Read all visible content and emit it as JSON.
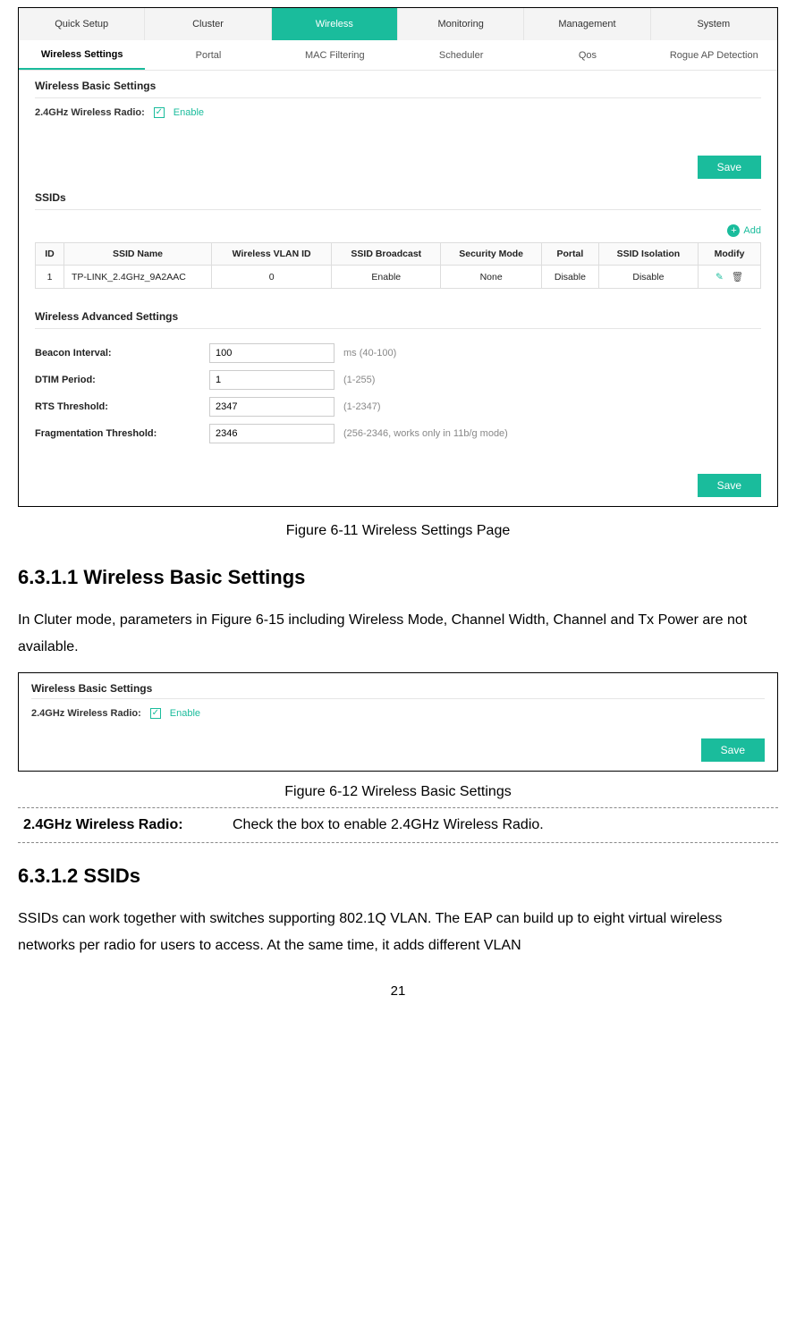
{
  "mainTabs": [
    "Quick Setup",
    "Cluster",
    "Wireless",
    "Monitoring",
    "Management",
    "System"
  ],
  "mainActive": 2,
  "subTabs": [
    "Wireless Settings",
    "Portal",
    "MAC Filtering",
    "Scheduler",
    "Qos",
    "Rogue AP Detection"
  ],
  "subActive": 0,
  "basic": {
    "title": "Wireless Basic Settings",
    "radioLabel": "2.4GHz Wireless Radio:",
    "enable": "Enable"
  },
  "saveLabel": "Save",
  "ssids": {
    "title": "SSIDs",
    "addLabel": "Add",
    "headers": [
      "ID",
      "SSID Name",
      "Wireless VLAN ID",
      "SSID Broadcast",
      "Security Mode",
      "Portal",
      "SSID Isolation",
      "Modify"
    ],
    "row": {
      "id": "1",
      "name": "TP-LINK_2.4GHz_9A2AAC",
      "vlan": "0",
      "bc": "Enable",
      "sec": "None",
      "portal": "Disable",
      "iso": "Disable"
    }
  },
  "adv": {
    "title": "Wireless Advanced Settings",
    "rows": [
      {
        "label": "Beacon Interval:",
        "value": "100",
        "hint": "ms (40-100)"
      },
      {
        "label": "DTIM Period:",
        "value": "1",
        "hint": "(1-255)"
      },
      {
        "label": "RTS Threshold:",
        "value": "2347",
        "hint": "(1-2347)"
      },
      {
        "label": "Fragmentation Threshold:",
        "value": "2346",
        "hint": "(256-2346, works only in 11b/g mode)"
      }
    ]
  },
  "cap1": "Figure 6-11 Wireless Settings Page",
  "sec1": "6.3.1.1  Wireless Basic Settings",
  "para1": "In Cluter mode, parameters in Figure 6-15 including Wireless Mode, Channel Width, Channel and Tx Power are not available.",
  "cap2": "Figure 6-12 Wireless Basic Settings",
  "defTerm": "2.4GHz Wireless Radio:",
  "defDesc": "Check the box to enable 2.4GHz Wireless Radio.",
  "sec2": "6.3.1.2  SSIDs",
  "para2": "SSIDs can work together with switches supporting 802.1Q VLAN. The EAP can build up to eight virtual wireless networks per radio for users to access. At the same time, it adds different VLAN",
  "pageNumber": "21"
}
